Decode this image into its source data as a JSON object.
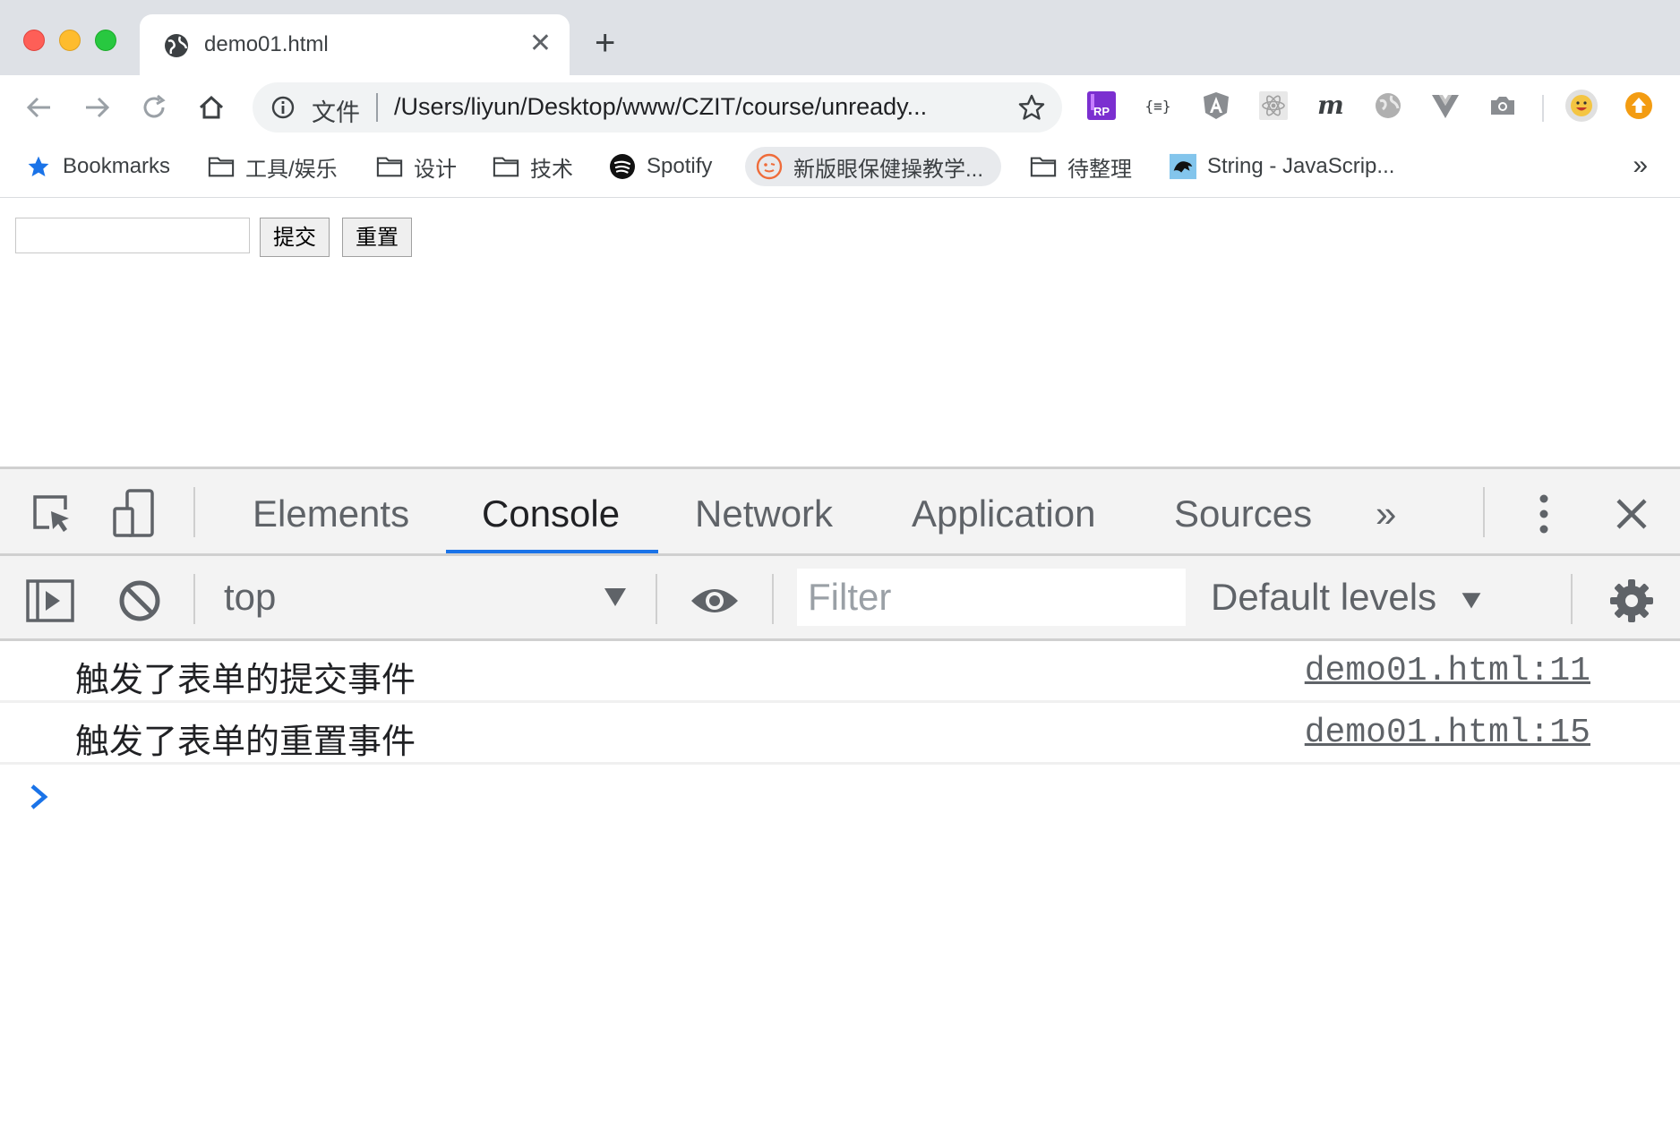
{
  "tab": {
    "title": "demo01.html",
    "close_glyph": "✕",
    "new_tab_glyph": "+"
  },
  "omnibox": {
    "scheme_label": "文件",
    "url": "/Users/liyun/Desktop/www/CZIT/course/unready..."
  },
  "bookmarks": {
    "items": [
      {
        "label": "Bookmarks",
        "icon": "star-icon"
      },
      {
        "label": "工具/娱乐",
        "icon": "folder-icon"
      },
      {
        "label": "设计",
        "icon": "folder-icon"
      },
      {
        "label": "技术",
        "icon": "folder-icon"
      },
      {
        "label": "Spotify",
        "icon": "spotify-icon"
      },
      {
        "label": "新版眼保健操教学...",
        "icon": "face-icon"
      },
      {
        "label": "待整理",
        "icon": "folder-icon"
      },
      {
        "label": "String - JavaScrip...",
        "icon": "mdn-icon"
      }
    ],
    "more_glyph": "»"
  },
  "page": {
    "input_value": "",
    "submit_label": "提交",
    "reset_label": "重置"
  },
  "devtools": {
    "tabs": [
      "Elements",
      "Console",
      "Network",
      "Application",
      "Sources"
    ],
    "active_tab": "Console",
    "more_tabs_glyph": "»",
    "context": "top",
    "filter_placeholder": "Filter",
    "levels_label": "Default levels",
    "accent": "#1a73e8"
  },
  "console": {
    "messages": [
      {
        "text": "触发了表单的提交事件",
        "source": "demo01.html:11"
      },
      {
        "text": "触发了表单的重置事件",
        "source": "demo01.html:15"
      }
    ]
  }
}
